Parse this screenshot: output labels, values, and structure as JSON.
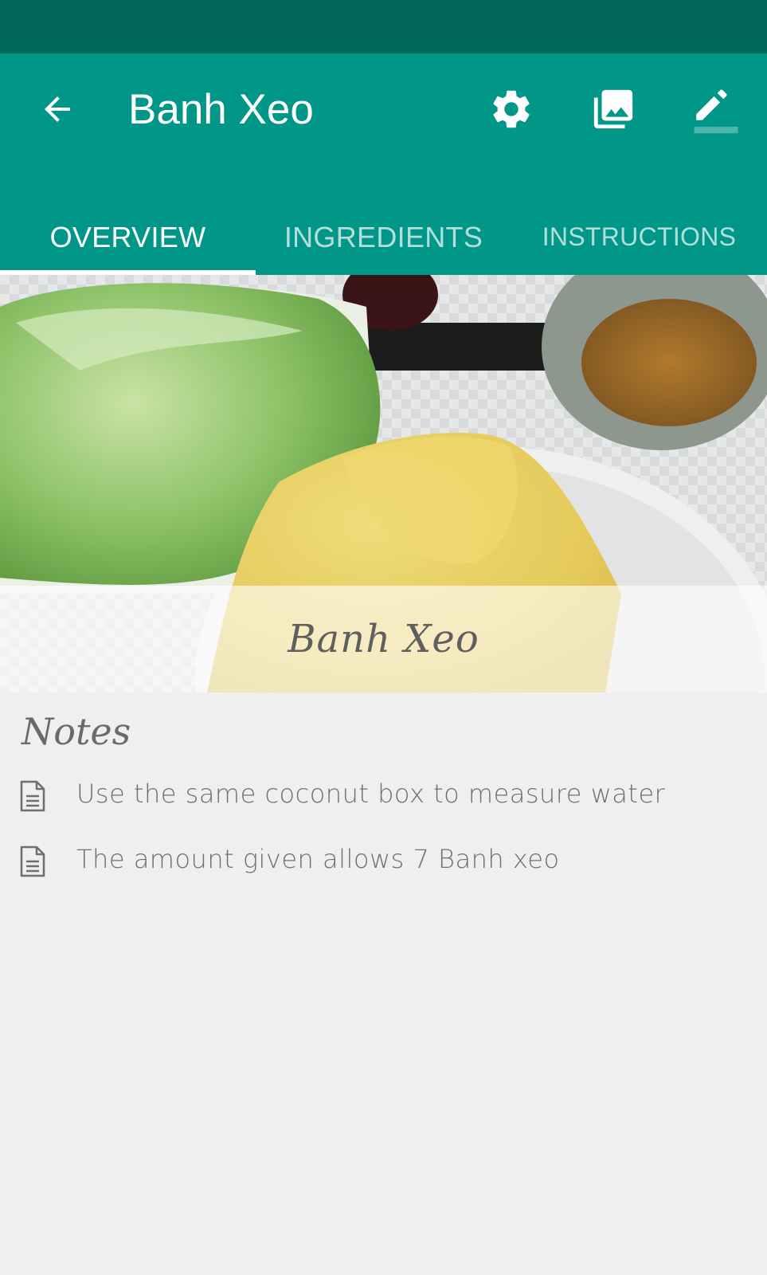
{
  "app_bar": {
    "title": "Banh Xeo",
    "back_icon": "arrow-back-icon",
    "actions": [
      {
        "name": "settings",
        "icon": "gear-icon"
      },
      {
        "name": "gallery",
        "icon": "photo-library-icon"
      },
      {
        "name": "edit",
        "icon": "pencil-icon"
      }
    ],
    "colors": {
      "status_bar": "#00695c",
      "primary": "#009688",
      "tab_inactive": "#b2dfdb"
    }
  },
  "tabs": [
    {
      "label": "OVERVIEW",
      "active": true
    },
    {
      "label": "INGREDIENTS",
      "active": false
    },
    {
      "label": "INSTRUCTIONS",
      "active": false
    }
  ],
  "hero": {
    "caption": "Banh Xeo"
  },
  "notes": {
    "heading": "Notes",
    "items": [
      {
        "icon": "document-icon",
        "text": "Use the same coconut box to measure water"
      },
      {
        "icon": "document-icon",
        "text": "The amount given allows 7 Banh xeo"
      }
    ]
  }
}
